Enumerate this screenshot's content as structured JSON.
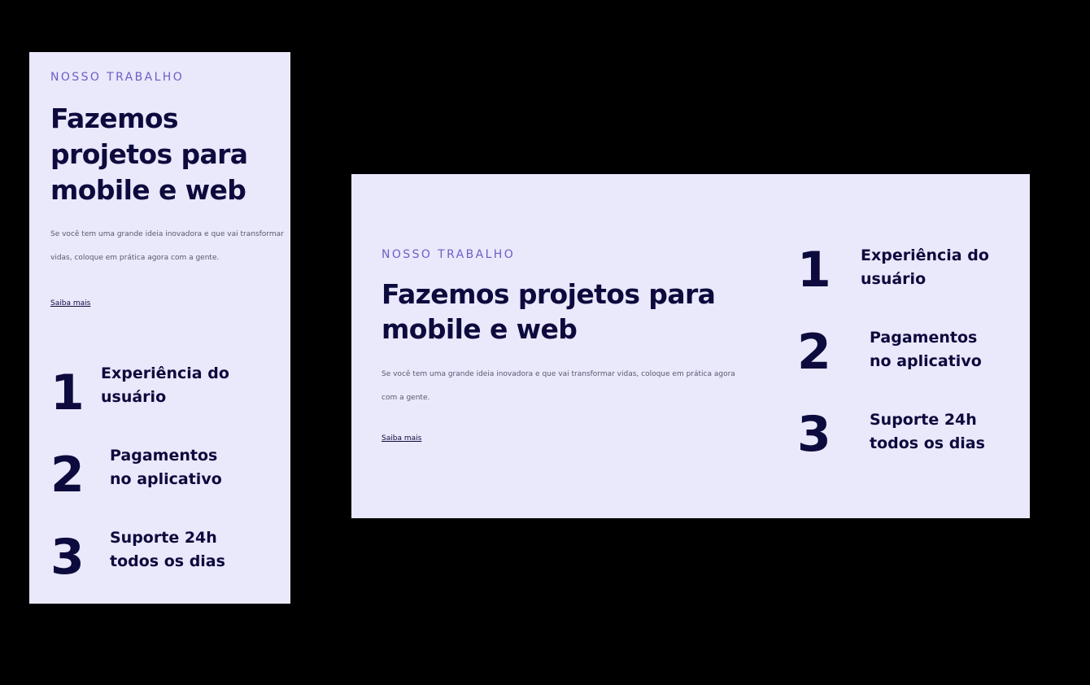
{
  "mobile": {
    "eyebrow": "NOSSO TRABALHO",
    "headline": "Fazemos projetos para mobile e web",
    "description": "Se você tem uma grande ideia inovadora e que vai transformar vidas, coloque em prática agora com a gente.",
    "link": "Saiba mais",
    "features": [
      {
        "number": "1",
        "line1": "Experiência do",
        "line2": "usuário"
      },
      {
        "number": "2",
        "line1": "Pagamentos",
        "line2": "no aplicativo"
      },
      {
        "number": "3",
        "line1": "Suporte 24h",
        "line2": "todos os dias"
      }
    ]
  },
  "desktop": {
    "eyebrow": "NOSSO TRABALHO",
    "headline": "Fazemos projetos para mobile e web",
    "description": "Se você tem uma grande ideia inovadora e que vai transformar vidas, coloque em prática agora com a gente.",
    "link": "Saiba mais",
    "features": [
      {
        "number": "1",
        "line1": "Experiência do",
        "line2": "usuário"
      },
      {
        "number": "2",
        "line1": "Pagamentos",
        "line2": "no aplicativo"
      },
      {
        "number": "3",
        "line1": "Suporte 24h",
        "line2": "todos os dias"
      }
    ]
  },
  "colors": {
    "background": "#000000",
    "card": "#eae8fb",
    "eyebrow": "#6b5fc4",
    "heading": "#0d0a3d",
    "body": "#5a5870"
  }
}
